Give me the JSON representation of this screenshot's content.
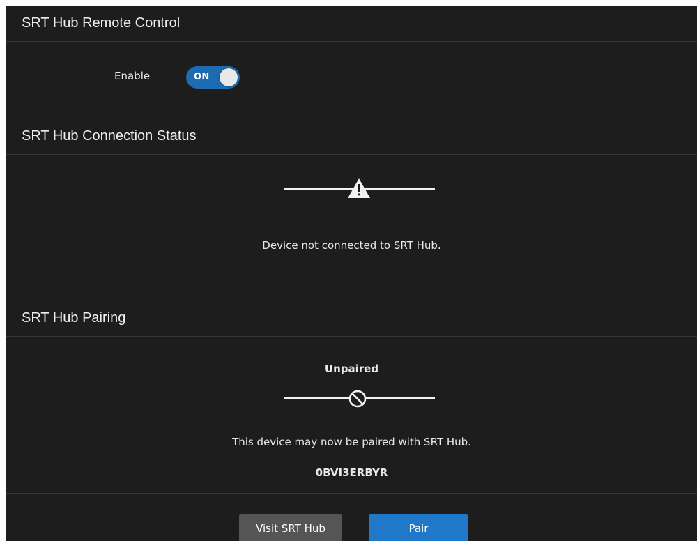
{
  "remote_control": {
    "header": "SRT Hub Remote Control",
    "enable_label": "Enable",
    "toggle_text": "ON"
  },
  "connection": {
    "header": "SRT Hub Connection Status",
    "icon": "warning-triangle-icon",
    "message": "Device not connected to SRT Hub."
  },
  "pairing": {
    "header": "SRT Hub Pairing",
    "status": "Unpaired",
    "icon": "prohibited-icon",
    "message": "This device may now be paired with SRT Hub.",
    "code": "0BVI3ERBYR"
  },
  "buttons": {
    "visit_label": "Visit SRT Hub",
    "pair_label": "Pair"
  },
  "colors": {
    "panel_bg": "#1d1d1d",
    "accent": "#1f78c8",
    "toggle_on": "#1d6bb0",
    "secondary_button": "#555555"
  }
}
